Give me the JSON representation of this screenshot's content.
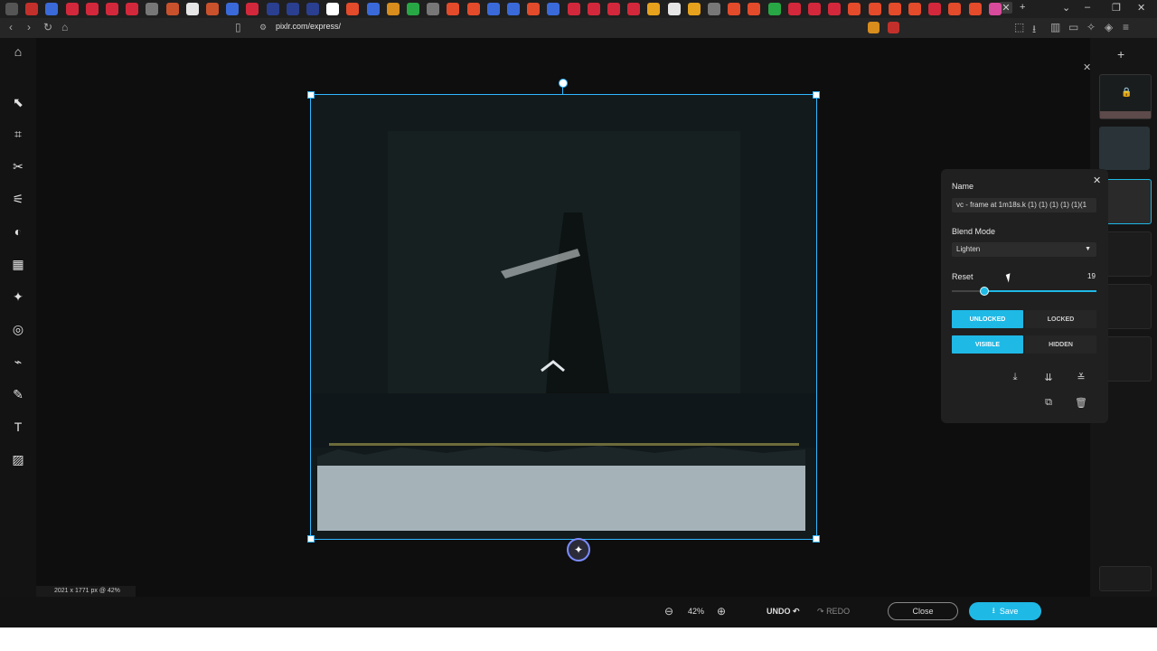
{
  "browser": {
    "url": "pixlr.com/express/",
    "tab_colors": [
      "#555",
      "#c3302b",
      "#3a6ad9",
      "#d3283b",
      "#d3283b",
      "#d3283b",
      "#d3283b",
      "#777",
      "#c9522d",
      "#e6e6e6",
      "#c9522d",
      "#3a6ad9",
      "#d3283b",
      "#2a3f8f",
      "#2a3f8f",
      "#2a3f8f",
      "#ffffff",
      "#e34b2b",
      "#3a6ad9",
      "#d88d1c",
      "#28a745",
      "#777",
      "#e34b2b",
      "#e34b2b",
      "#3a6ad9",
      "#3a6ad9",
      "#e34b2b",
      "#3a6ad9",
      "#d3283b",
      "#d3283b",
      "#d3283b",
      "#d3283b",
      "#e6a21c",
      "#e6e6e6",
      "#e6a21c",
      "#777",
      "#e34b2b",
      "#e34b2b",
      "#28a745",
      "#d3283b",
      "#d3283b",
      "#d3283b",
      "#e34b2b",
      "#e34b2b",
      "#e34b2b",
      "#e34b2b",
      "#d3283b",
      "#e34b2b",
      "#e34b2b",
      "#d84a9b"
    ]
  },
  "sidebar": {
    "tools": [
      "home-icon",
      "arrange-icon",
      "crop-icon",
      "cutout-icon",
      "adjust-icon",
      "filter-icon",
      "effect-icon",
      "retouch-icon",
      "liquify-icon",
      "healing-icon",
      "draw-icon",
      "text-icon",
      "hatch-icon"
    ]
  },
  "layer_panel": {
    "name_label": "Name",
    "name_value": "vc - frame at 1m18s.k (1) (1) (1) (1) (1)(1",
    "blend_label": "Blend Mode",
    "blend_value": "Lighten",
    "reset_label": "Reset",
    "opacity_value": "19",
    "opacity": 0.19,
    "unlocked": "UNLOCKED",
    "locked": "LOCKED",
    "visible": "VISIBLE",
    "hidden": "HIDDEN"
  },
  "status": {
    "info": "2021 x 1771 px @ 42%"
  },
  "bottom": {
    "zoom": "42%",
    "undo": "UNDO",
    "redo": "REDO",
    "close": "Close",
    "save": "Save"
  },
  "colors": {
    "accent": "#1fb9e6",
    "selection": "#2fb8ff"
  }
}
